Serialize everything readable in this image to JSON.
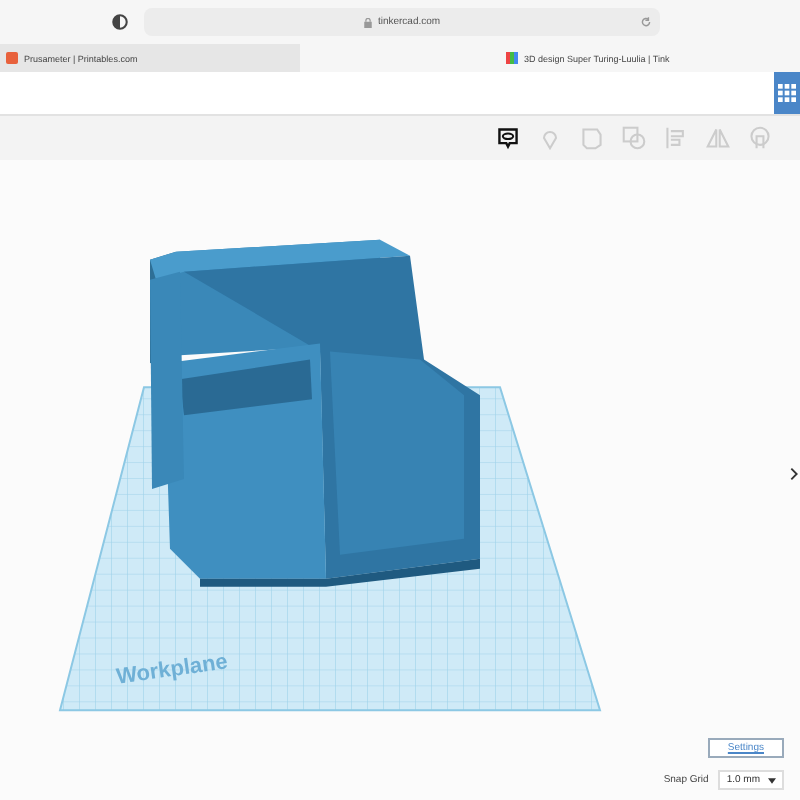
{
  "browser": {
    "address": "tinkercad.com",
    "tabs": [
      {
        "title": "Prusameter | Printables.com",
        "selected": false
      },
      {
        "title": "3D design Super Turing-Luulia | Tink",
        "selected": true
      }
    ]
  },
  "workplane": {
    "label": "Workplane"
  },
  "settings_button": "Settings",
  "snap_grid": {
    "label": "Snap Grid",
    "value": "1.0 mm"
  }
}
